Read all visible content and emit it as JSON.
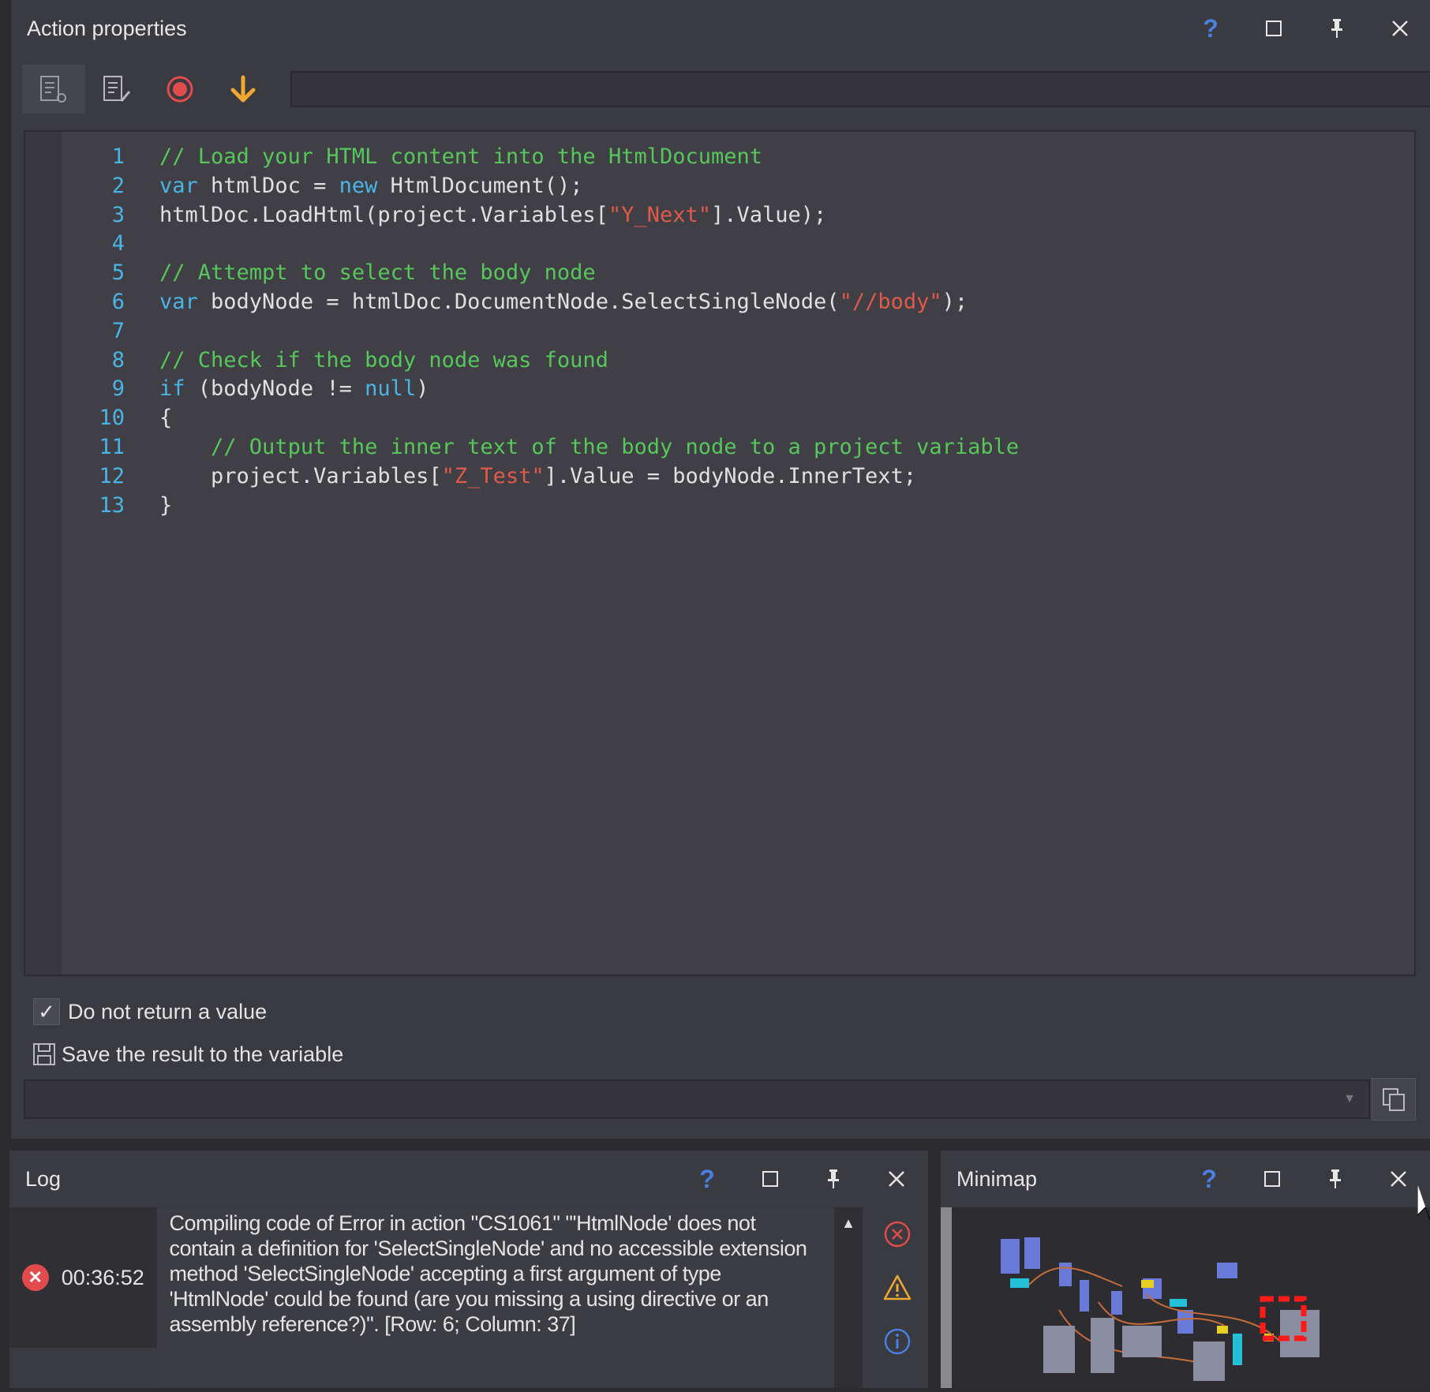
{
  "action_panel": {
    "title": "Action properties",
    "toolbar_input_value": "",
    "code_lines": [
      {
        "n": "1",
        "tokens": [
          {
            "t": "comment",
            "v": "// Load your HTML content into the HtmlDocument"
          }
        ]
      },
      {
        "n": "2",
        "tokens": [
          {
            "t": "keyword",
            "v": "var"
          },
          {
            "t": "plain",
            "v": " htmlDoc = "
          },
          {
            "t": "keyword",
            "v": "new"
          },
          {
            "t": "plain",
            "v": " HtmlDocument();"
          }
        ]
      },
      {
        "n": "3",
        "tokens": [
          {
            "t": "plain",
            "v": "htmlDoc.LoadHtml(project.Variables["
          },
          {
            "t": "string",
            "v": "\"Y_Next\""
          },
          {
            "t": "plain",
            "v": "].Value);"
          }
        ]
      },
      {
        "n": "4",
        "tokens": []
      },
      {
        "n": "5",
        "tokens": [
          {
            "t": "comment",
            "v": "// Attempt to select the body node"
          }
        ]
      },
      {
        "n": "6",
        "tokens": [
          {
            "t": "keyword",
            "v": "var"
          },
          {
            "t": "plain",
            "v": " bodyNode = htmlDoc.DocumentNode.SelectSingleNode("
          },
          {
            "t": "string",
            "v": "\"//body\""
          },
          {
            "t": "plain",
            "v": ");"
          }
        ]
      },
      {
        "n": "7",
        "tokens": []
      },
      {
        "n": "8",
        "tokens": [
          {
            "t": "comment",
            "v": "// Check if the body node was found"
          }
        ]
      },
      {
        "n": "9",
        "tokens": [
          {
            "t": "keyword",
            "v": "if"
          },
          {
            "t": "plain",
            "v": " (bodyNode != "
          },
          {
            "t": "keyword",
            "v": "null"
          },
          {
            "t": "plain",
            "v": ")"
          }
        ]
      },
      {
        "n": "10",
        "tokens": [
          {
            "t": "plain",
            "v": "{"
          }
        ]
      },
      {
        "n": "11",
        "tokens": [
          {
            "t": "plain",
            "v": "    "
          },
          {
            "t": "comment",
            "v": "// Output the inner text of the body node to a project variable"
          }
        ]
      },
      {
        "n": "12",
        "tokens": [
          {
            "t": "plain",
            "v": "    project.Variables["
          },
          {
            "t": "string",
            "v": "\"Z_Test\""
          },
          {
            "t": "plain",
            "v": "].Value = bodyNode.InnerText;"
          }
        ]
      },
      {
        "n": "13",
        "tokens": [
          {
            "t": "plain",
            "v": "}"
          }
        ]
      }
    ],
    "do_not_return_label": "Do not return a value",
    "do_not_return_checked": true,
    "save_result_label": "Save the result to the variable",
    "variable_value": ""
  },
  "log_panel": {
    "title": "Log",
    "entries": [
      {
        "level": "error",
        "time": "00:36:52",
        "message": "Compiling code of  Error in action \"CS1061\" \"'HtmlNode' does not contain a definition for 'SelectSingleNode' and no accessible extension method 'SelectSingleNode' accepting a first argument of type 'HtmlNode' could be found (are you missing a using directive or an assembly reference?)\". [Row: 6; Column: 37]"
      }
    ]
  },
  "minimap_panel": {
    "title": "Minimap"
  },
  "colors": {
    "comment": "#57c75b",
    "keyword": "#4ab4e6",
    "string": "#e05a4a",
    "help": "#4a7fe0",
    "record": "#e14b4b",
    "arrow": "#f0a830"
  }
}
